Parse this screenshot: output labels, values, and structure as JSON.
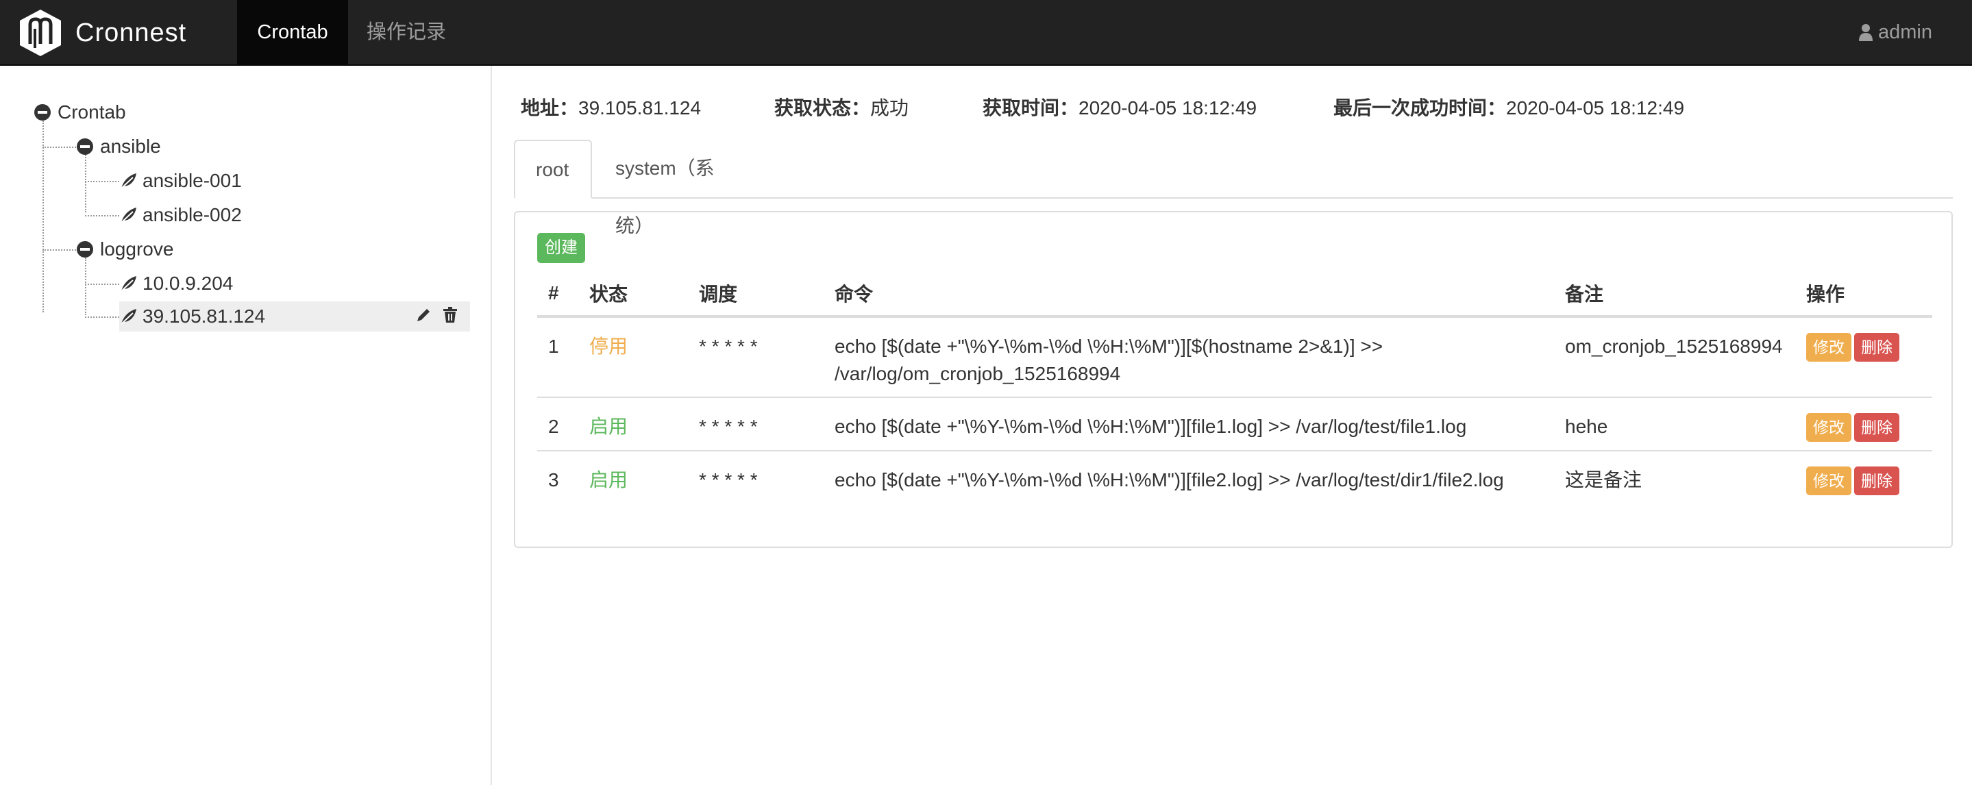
{
  "brand": {
    "name": "Cronnest",
    "logo_icon": "cronnest-logo-icon"
  },
  "nav": {
    "items": [
      {
        "label": "Crontab",
        "active": true
      },
      {
        "label": "操作记录",
        "active": false
      }
    ],
    "user": {
      "label": "admin",
      "icon": "user-icon"
    }
  },
  "tree": {
    "root": {
      "label": "Crontab",
      "expanded": true
    },
    "groups": [
      {
        "label": "ansible",
        "expanded": true,
        "children": [
          "ansible-001",
          "ansible-002"
        ]
      },
      {
        "label": "loggrove",
        "expanded": true,
        "children": [
          "10.0.9.204",
          "39.105.81.124"
        ]
      }
    ],
    "selected": "39.105.81.124"
  },
  "info": {
    "address_label": "地址：",
    "address_value": "39.105.81.124",
    "status_label": "获取状态：",
    "status_value": "成功",
    "time_label": "获取时间：",
    "time_value": "2020-04-05 18:12:49",
    "last_label": "最后一次成功时间：",
    "last_value": "2020-04-05 18:12:49"
  },
  "tabs": [
    {
      "label": "root",
      "active": true
    },
    {
      "label": "system（系统）",
      "active": false
    }
  ],
  "panel": {
    "create_label": "创建",
    "columns": [
      "#",
      "状态",
      "调度",
      "命令",
      "备注",
      "操作"
    ],
    "rows": [
      {
        "index": "1",
        "status": "停用",
        "schedule": "* * * * *",
        "command_line1": "echo [$(date +\"\\%Y-\\%m-\\%d \\%H:\\%M\")][$(hostname 2>&1)] >>",
        "command_line2": "/var/log/om_cronjob_1525168994",
        "remark": "om_cronjob_1525168994"
      },
      {
        "index": "2",
        "status": "启用",
        "schedule": "* * * * *",
        "command_line1": "echo [$(date +\"\\%Y-\\%m-\\%d \\%H:\\%M\")][file1.log] >> /var/log/test/file1.log",
        "command_line2": "",
        "remark": "hehe"
      },
      {
        "index": "3",
        "status": "启用",
        "schedule": "* * * * *",
        "command_line1": "echo [$(date +\"\\%Y-\\%m-\\%d \\%H:\\%M\")][file2.log] >> /var/log/test/dir1/file2.log",
        "command_line2": "",
        "remark": "这是备注"
      }
    ],
    "edit_label": "修改",
    "delete_label": "删除"
  },
  "colors": {
    "success": "#5cb85c",
    "warning": "#f0ad4e",
    "danger": "#d9534f",
    "navbar": "#222222"
  }
}
